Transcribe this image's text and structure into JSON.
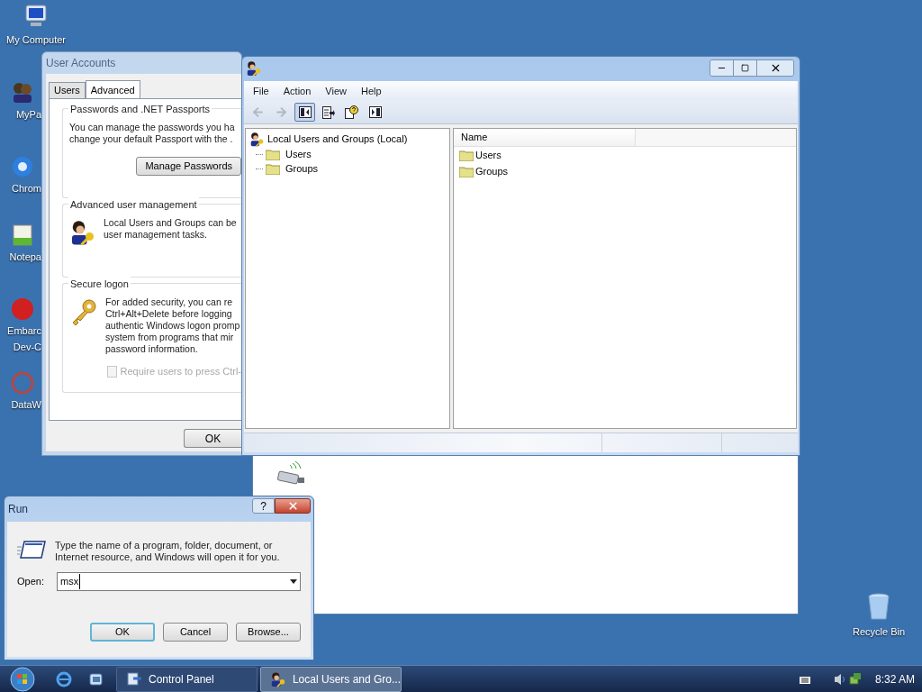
{
  "desktop_icons": [
    {
      "lines": [
        "My Computer"
      ]
    },
    {
      "lines": [
        "MyPa"
      ]
    },
    {
      "lines": [
        "Chrom"
      ]
    },
    {
      "lines": [
        "Notepa"
      ]
    },
    {
      "lines": [
        "Embarc",
        "Dev-C"
      ]
    },
    {
      "lines": [
        "DataW"
      ]
    }
  ],
  "recycle_bin": {
    "label": "Recycle Bin"
  },
  "user_accounts": {
    "title": "User Accounts",
    "tabs": [
      {
        "label": "Users",
        "selected": false
      },
      {
        "label": "Advanced",
        "selected": true
      }
    ],
    "sections": [
      {
        "kind": "passwords",
        "title": "Passwords and .NET Passports",
        "lines": [
          "You can manage the passwords you ha",
          "change your default Passport with the ."
        ],
        "button": "Manage Passwords"
      },
      {
        "kind": "users",
        "title": "Advanced user management",
        "lines": [
          "Local Users and Groups can be",
          "user management tasks."
        ]
      },
      {
        "kind": "logon",
        "title": "Secure logon",
        "lines": [
          "For added security, you can re",
          "Ctrl+Alt+Delete before logging",
          "authentic Windows logon promp",
          "system from programs that mir",
          "password information."
        ],
        "checkbox": {
          "label": "Require users to press Ctrl-",
          "checked": false,
          "disabled": true
        }
      }
    ],
    "ok_button": "OK"
  },
  "mmc": {
    "menu": [
      "File",
      "Action",
      "View",
      "Help"
    ],
    "toolbar": [
      {
        "kind": "back",
        "disabled": true
      },
      {
        "kind": "forward",
        "disabled": true
      },
      {
        "kind": "tree",
        "selected": true
      },
      {
        "kind": "export",
        "selected": false
      },
      {
        "kind": "help",
        "selected": false
      },
      {
        "kind": "pane",
        "selected": false
      }
    ],
    "tree": {
      "label": "Local Users and Groups (Local)",
      "children": [
        {
          "label": "Users"
        },
        {
          "label": "Groups"
        }
      ]
    },
    "list": {
      "columns": [
        "Name"
      ],
      "rows": [
        "Users",
        "Groups"
      ]
    }
  },
  "run_dialog": {
    "title": "Run",
    "help_button": "?",
    "description": "Type the name of a program, folder, document, or Internet resource, and Windows will open it for you.",
    "open_label": "Open:",
    "value": "msx",
    "buttons": [
      {
        "label": "OK",
        "default": true
      },
      {
        "label": "Cancel",
        "default": false
      },
      {
        "label": "Browse...",
        "default": false
      }
    ]
  },
  "taskbar": {
    "buttons": [
      {
        "label": "Control Panel",
        "selected": false
      },
      {
        "label": "Local Users and Gro...",
        "selected": true
      }
    ],
    "clock": "8:32 AM"
  }
}
